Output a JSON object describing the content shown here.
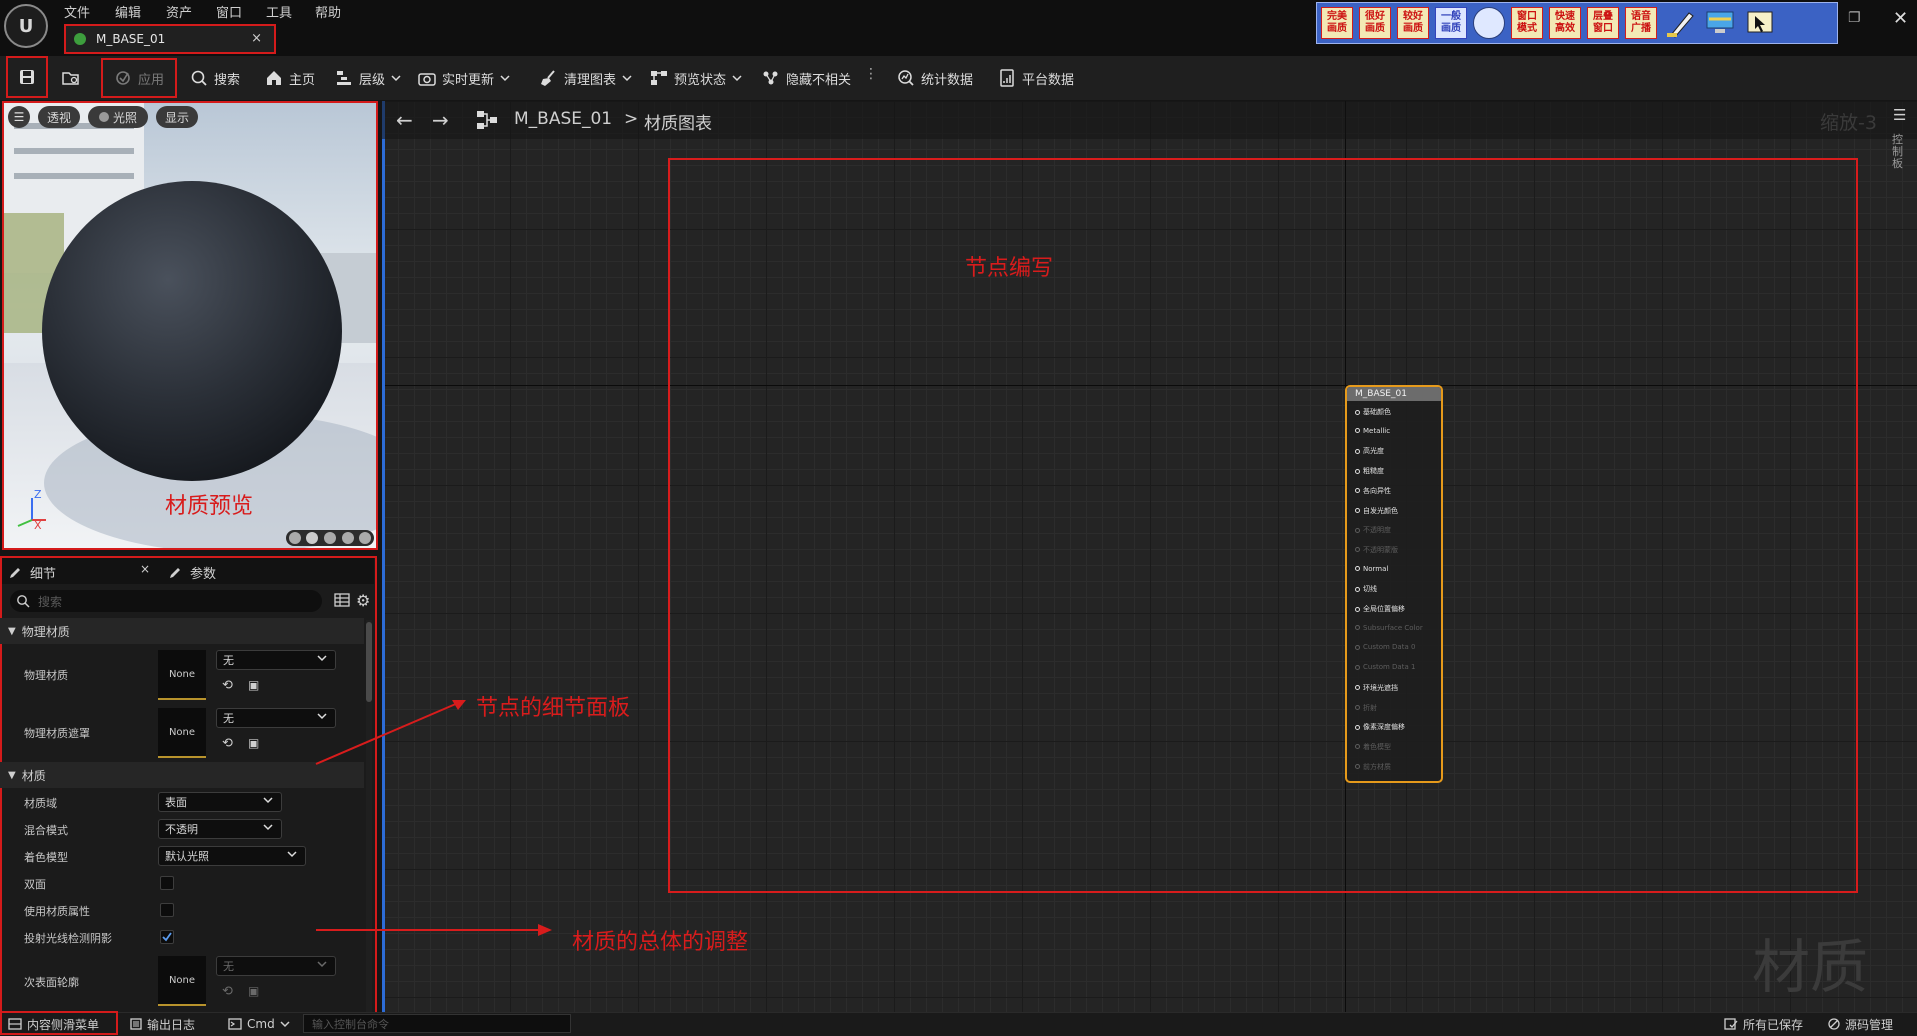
{
  "menu": [
    "文件",
    "编辑",
    "资产",
    "窗口",
    "工具",
    "帮助"
  ],
  "doc_tab": {
    "label": "M_BASE_01",
    "close": "×"
  },
  "quality_buttons": [
    "完美\n画质",
    "很好\n画质",
    "较好\n画质",
    "一般\n画质",
    "窗口\n模式",
    "快速\n高效",
    "层叠\n窗口",
    "语音\n广播"
  ],
  "toolbar": {
    "apply": "应用",
    "search": "搜索",
    "home": "主页",
    "hierarchy": "层级",
    "live_update": "实时更新",
    "clean_graph": "清理图表",
    "preview_state": "预览状态",
    "hide_unrelated": "隐藏不相关",
    "stats": "统计数据",
    "platform_stats": "平台数据"
  },
  "viewport": {
    "perspective": "透视",
    "lit": "光照",
    "show": "显示",
    "axis_z": "Z",
    "axis_x": "X"
  },
  "details": {
    "tab_details": "细节",
    "tab_params": "参数",
    "search_placeholder": "搜索",
    "section_physical": "物理材质",
    "phys_mat_label": "物理材质",
    "phys_mat_value": "无",
    "phys_mat_thumb": "None",
    "phys_mask_label": "物理材质遮罩",
    "phys_mask_value": "无",
    "phys_mask_thumb": "None",
    "section_material": "材质",
    "domain_label": "材质域",
    "domain_value": "表面",
    "blend_label": "混合模式",
    "blend_value": "不透明",
    "shading_label": "着色模型",
    "shading_value": "默认光照",
    "two_sided_label": "双面",
    "use_attr_label": "使用材质属性",
    "ray_shadow_label": "投射光线检测阴影",
    "subsurface_label": "次表面轮廓",
    "subsurface_value": "无",
    "subsurface_thumb": "None"
  },
  "graph": {
    "breadcrumb_asset": "M_BASE_01",
    "breadcrumb_sep": ">",
    "breadcrumb_graph": "材质图表",
    "zoom": "缩放-3",
    "watermark": "材质",
    "side_tab": "控制板"
  },
  "node": {
    "title": "M_BASE_01",
    "pins": [
      {
        "label": "基础颜色",
        "enabled": true
      },
      {
        "label": "Metallic",
        "enabled": true
      },
      {
        "label": "高光度",
        "enabled": true
      },
      {
        "label": "粗糙度",
        "enabled": true
      },
      {
        "label": "各向异性",
        "enabled": true
      },
      {
        "label": "自发光颜色",
        "enabled": true
      },
      {
        "label": "不透明度",
        "enabled": false
      },
      {
        "label": "不透明蒙版",
        "enabled": false
      },
      {
        "label": "Normal",
        "enabled": true
      },
      {
        "label": "切线",
        "enabled": true
      },
      {
        "label": "全局位置偏移",
        "enabled": true
      },
      {
        "label": "Subsurface Color",
        "enabled": false
      },
      {
        "label": "Custom Data 0",
        "enabled": false
      },
      {
        "label": "Custom Data 1",
        "enabled": false
      },
      {
        "label": "环境光遮挡",
        "enabled": true
      },
      {
        "label": "折射",
        "enabled": false
      },
      {
        "label": "像素深度偏移",
        "enabled": true
      },
      {
        "label": "着色模型",
        "enabled": false
      },
      {
        "label": "前方材质",
        "enabled": false
      }
    ]
  },
  "annotations": {
    "node_edit": "节点编写",
    "material_preview": "材质预览",
    "detail_panel": "节点的细节面板",
    "overall_adjust": "材质的总体的调整"
  },
  "statusbar": {
    "content_drawer": "内容侧滑菜单",
    "output_log": "输出日志",
    "cmd": "Cmd",
    "console_placeholder": "输入控制台命令",
    "all_saved": "所有已保存",
    "source_control": "源码管理"
  },
  "colors": {
    "annotation_red": "#d81c1c",
    "node_border": "#e69a1b",
    "quality_blue": "#3b62c4"
  }
}
